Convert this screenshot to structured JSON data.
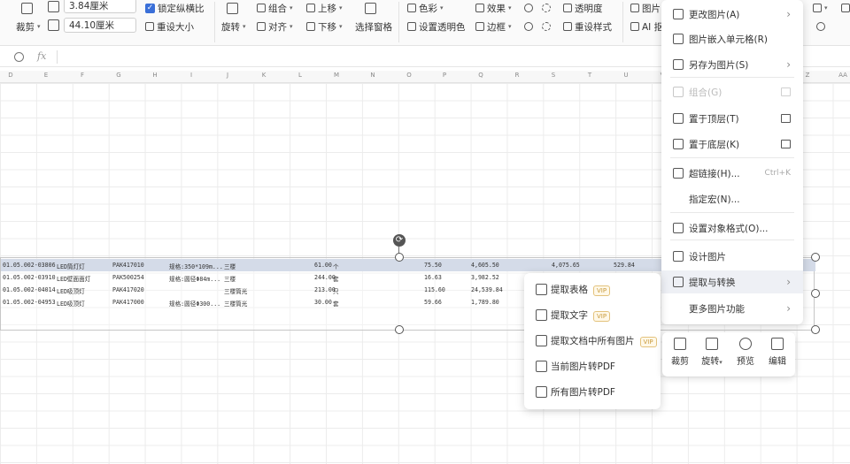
{
  "ribbon": {
    "crop_label": "裁剪",
    "height_value": "3.84厘米",
    "width_value": "44.10厘米",
    "lock_ratio_label": "锁定纵横比",
    "reset_size_label": "重设大小",
    "rotate_label": "旋转",
    "group_label": "组合",
    "align_label": "对齐",
    "bring_forward_label": "上移",
    "send_backward_label": "下移",
    "selection_pane_label": "选择窗格",
    "color_label": "色彩",
    "set_transparent_label": "设置透明色",
    "effects_label": "效果",
    "border_label": "边框",
    "transparency_label": "透明度",
    "reset_style_label": "重设样式",
    "picture_label": "图片",
    "ai_label": "AI 抠"
  },
  "formula_bar": {
    "fx_label": "fx"
  },
  "columns": [
    "D",
    "E",
    "F",
    "G",
    "H",
    "I",
    "J",
    "K",
    "L",
    "M",
    "N",
    "O",
    "P",
    "Q",
    "R",
    "S",
    "T",
    "U",
    "V",
    "W",
    "X",
    "Y",
    "Z",
    "AA"
  ],
  "data_rows": [
    {
      "code": "01.05.002-03806",
      "name": "LED筒灯灯",
      "model": "PAK417010",
      "spec": "规格:350*109m...",
      "unit_note": "三楼",
      "qty": "61.00",
      "unit": "个",
      "price": "75.50",
      "amount": "4,605.50",
      "extra": "4,075.65",
      "extra2": "529.84"
    },
    {
      "code": "01.05.002-03910",
      "name": "LED壁面面灯",
      "model": "PAK500254",
      "spec": "规格:圆径Φ84m...",
      "unit_note": "三楼",
      "qty": "244.00",
      "unit": "套",
      "price": "16.63",
      "amount": "3,982.52",
      "extra": "",
      "extra2": ""
    },
    {
      "code": "01.05.002-04014",
      "name": "LED吸顶灯",
      "model": "PAK417020",
      "spec": "",
      "unit_note": "三楼筒光",
      "qty": "213.00",
      "unit": "只",
      "price": "115.60",
      "amount": "24,539.84",
      "extra": "",
      "extra2": ""
    },
    {
      "code": "01.05.002-04953",
      "name": "LED吸顶灯",
      "model": "PAK417000",
      "spec": "规格:圆径Φ300...",
      "unit_note": "三楼筒光",
      "qty": "30.00",
      "unit": "套",
      "price": "59.66",
      "amount": "1,789.80",
      "extra": "",
      "extra2": ""
    }
  ],
  "context_menu": {
    "items": [
      {
        "label": "更改图片(A)",
        "icon": "change-picture-icon",
        "arrow": "›"
      },
      {
        "label": "图片嵌入单元格(R)",
        "icon": "embed-in-cell-icon"
      },
      {
        "label": "另存为图片(S)",
        "icon": "save-as-picture-icon",
        "arrow": "›"
      },
      {
        "label": "组合(G)",
        "icon": "group-icon",
        "disabled": true
      },
      {
        "label": "置于顶层(T)",
        "icon": "bring-to-front-icon"
      },
      {
        "label": "置于底层(K)",
        "icon": "send-to-back-icon"
      },
      {
        "label": "超链接(H)...",
        "icon": "hyperlink-icon",
        "shortcut": "Ctrl+K"
      },
      {
        "label": "指定宏(N)..."
      },
      {
        "label": "设置对象格式(O)...",
        "icon": "format-object-icon"
      },
      {
        "label": "设计图片",
        "icon": "design-picture-icon"
      },
      {
        "label": "提取与转换",
        "icon": "extract-convert-icon",
        "arrow": "›"
      },
      {
        "label": "更多图片功能",
        "arrow": "›"
      }
    ]
  },
  "submenu": {
    "items": [
      {
        "label": "提取表格",
        "vip": "VIP"
      },
      {
        "label": "提取文字",
        "vip": "VIP"
      },
      {
        "label": "提取文档中所有图片",
        "vip": "VIP"
      },
      {
        "label": "当前图片转PDF"
      },
      {
        "label": "所有图片转PDF"
      }
    ]
  },
  "mini_toolbar": {
    "crop": "裁剪",
    "rotate": "旋转",
    "preview": "预览",
    "edit": "编辑"
  }
}
